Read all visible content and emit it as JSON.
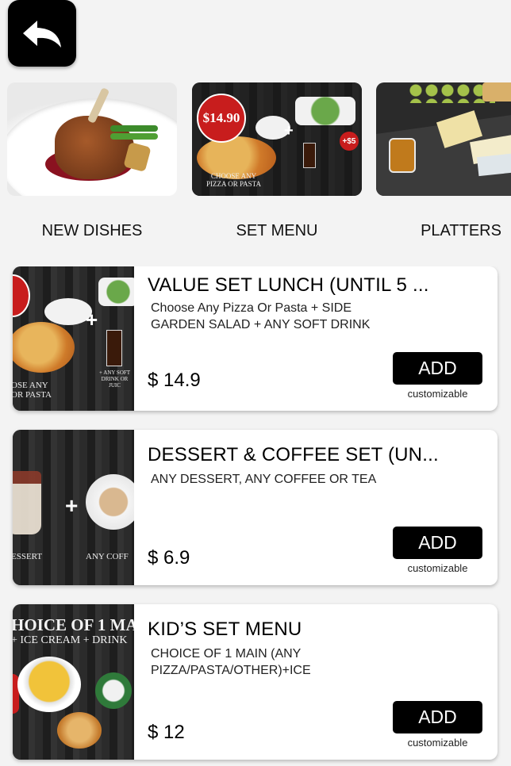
{
  "categories": [
    {
      "label": "NEW DISHES",
      "image": "duck-confit-plate"
    },
    {
      "label": "SET MENU",
      "image": "set-menu-promo",
      "badge": "$14.90",
      "extra": "+$5",
      "caption": "CHOOSE ANY\nPIZZA OR PASTA"
    },
    {
      "label": "PLATTERS",
      "image": "cheese-platter"
    }
  ],
  "items": [
    {
      "title": "VALUE SET LUNCH (UNTIL 5 ...",
      "description": "Choose Any  Pizza Or Pasta + SIDE\nGARDEN SALAD + ANY SOFT DRINK",
      "price": "$ 14.9",
      "add_label": "ADD",
      "note": "customizable",
      "image_caption": "OSE ANY\n OR PASTA",
      "image_caption_2": "+ ANY SOFT\nDRINK OR JUIC"
    },
    {
      "title": "DESSERT & COFFEE SET (UN...",
      "description": "ANY DESSERT,  ANY COFFEE OR TEA",
      "price": "$ 6.9",
      "add_label": "ADD",
      "note": "customizable",
      "image_caption": "ESSERT",
      "image_caption_2": "ANY COFF"
    },
    {
      "title": "KID’S SET MENU",
      "description": " CHOICE OF 1 MAIN (ANY\nPIZZA/PASTA/OTHER)+ICE",
      "price": "$ 12",
      "add_label": "ADD",
      "note": "customizable",
      "image_caption": "HOICE OF 1 MAI",
      "image_caption_2": "+ ICE CREAM + DRINK"
    }
  ],
  "colors": {
    "button": "#000000",
    "background": "#f3f3f3",
    "card": "#ffffff",
    "badge_red": "#c81d1d"
  }
}
